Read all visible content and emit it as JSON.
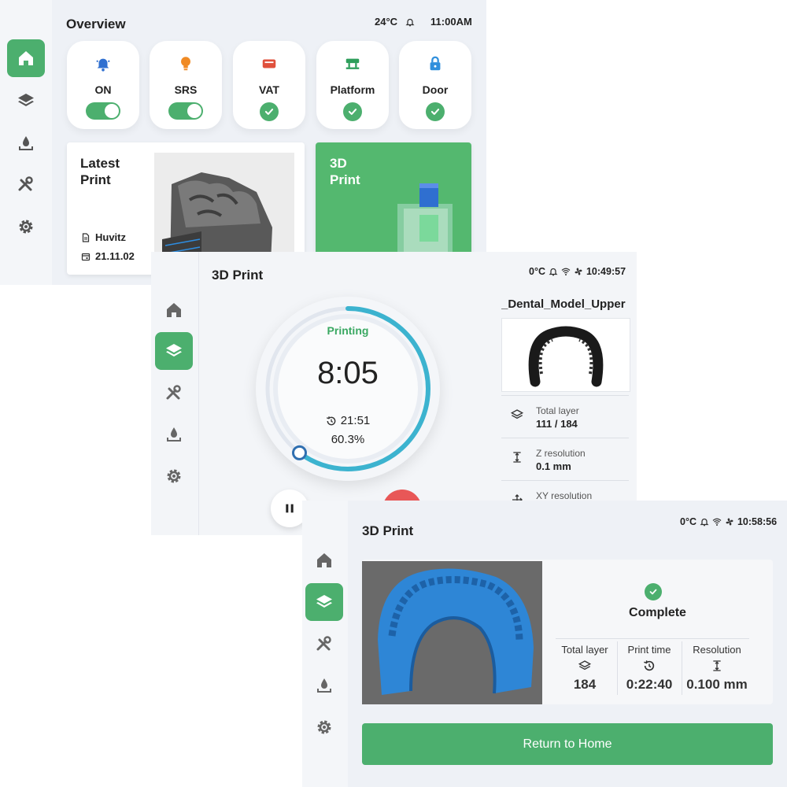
{
  "colors": {
    "accent": "#4caf6e",
    "ring": "#3cb3cf",
    "stop": "#e85757"
  },
  "overview": {
    "title": "Overview",
    "status": {
      "temperature": "24°C",
      "time": "11:00AM"
    },
    "sidebar_icons": [
      "home-icon",
      "layers-icon",
      "resin-icon",
      "tools-icon",
      "gear-icon"
    ],
    "tiles": [
      {
        "label": "ON",
        "icon": "bell-icon",
        "state": "toggle"
      },
      {
        "label": "SRS",
        "icon": "bulb-icon",
        "state": "toggle"
      },
      {
        "label": "VAT",
        "icon": "vat-icon",
        "state": "check"
      },
      {
        "label": "Platform",
        "icon": "platform-icon",
        "state": "check"
      },
      {
        "label": "Door",
        "icon": "lock-icon",
        "state": "check"
      }
    ],
    "latest_print": {
      "title_line1": "Latest",
      "title_line2": "Print",
      "name": "Huvitz",
      "date": "21.11.02"
    },
    "print_card": {
      "title_line1": "3D",
      "title_line2": "Print"
    }
  },
  "printing": {
    "title": "3D Print",
    "status": {
      "temperature": "0°C",
      "time": "10:49:57"
    },
    "state": "Printing",
    "remaining": "8:05",
    "elapsed": "21:51",
    "progress_label": "60.3%",
    "progress": 0.603,
    "model_name": "_Dental_Model_Upper",
    "info": [
      {
        "label": "Total layer",
        "value": "111 / 184",
        "icon": "layers-icon"
      },
      {
        "label": "Z resolution",
        "value": "0.1 mm",
        "icon": "z-resolution-icon"
      },
      {
        "label": "XY resolution",
        "value": "",
        "icon": "xy-resolution-icon"
      }
    ]
  },
  "complete": {
    "title": "3D Print",
    "status": {
      "temperature": "0°C",
      "time": "10:58:56"
    },
    "state": "Complete",
    "stats": [
      {
        "label": "Total layer",
        "value": "184",
        "icon": "layers-icon"
      },
      {
        "label": "Print time",
        "value": "0:22:40",
        "icon": "history-icon"
      },
      {
        "label": "Resolution",
        "value": "0.100 mm",
        "icon": "z-resolution-icon"
      }
    ],
    "return_button": "Return to Home"
  }
}
